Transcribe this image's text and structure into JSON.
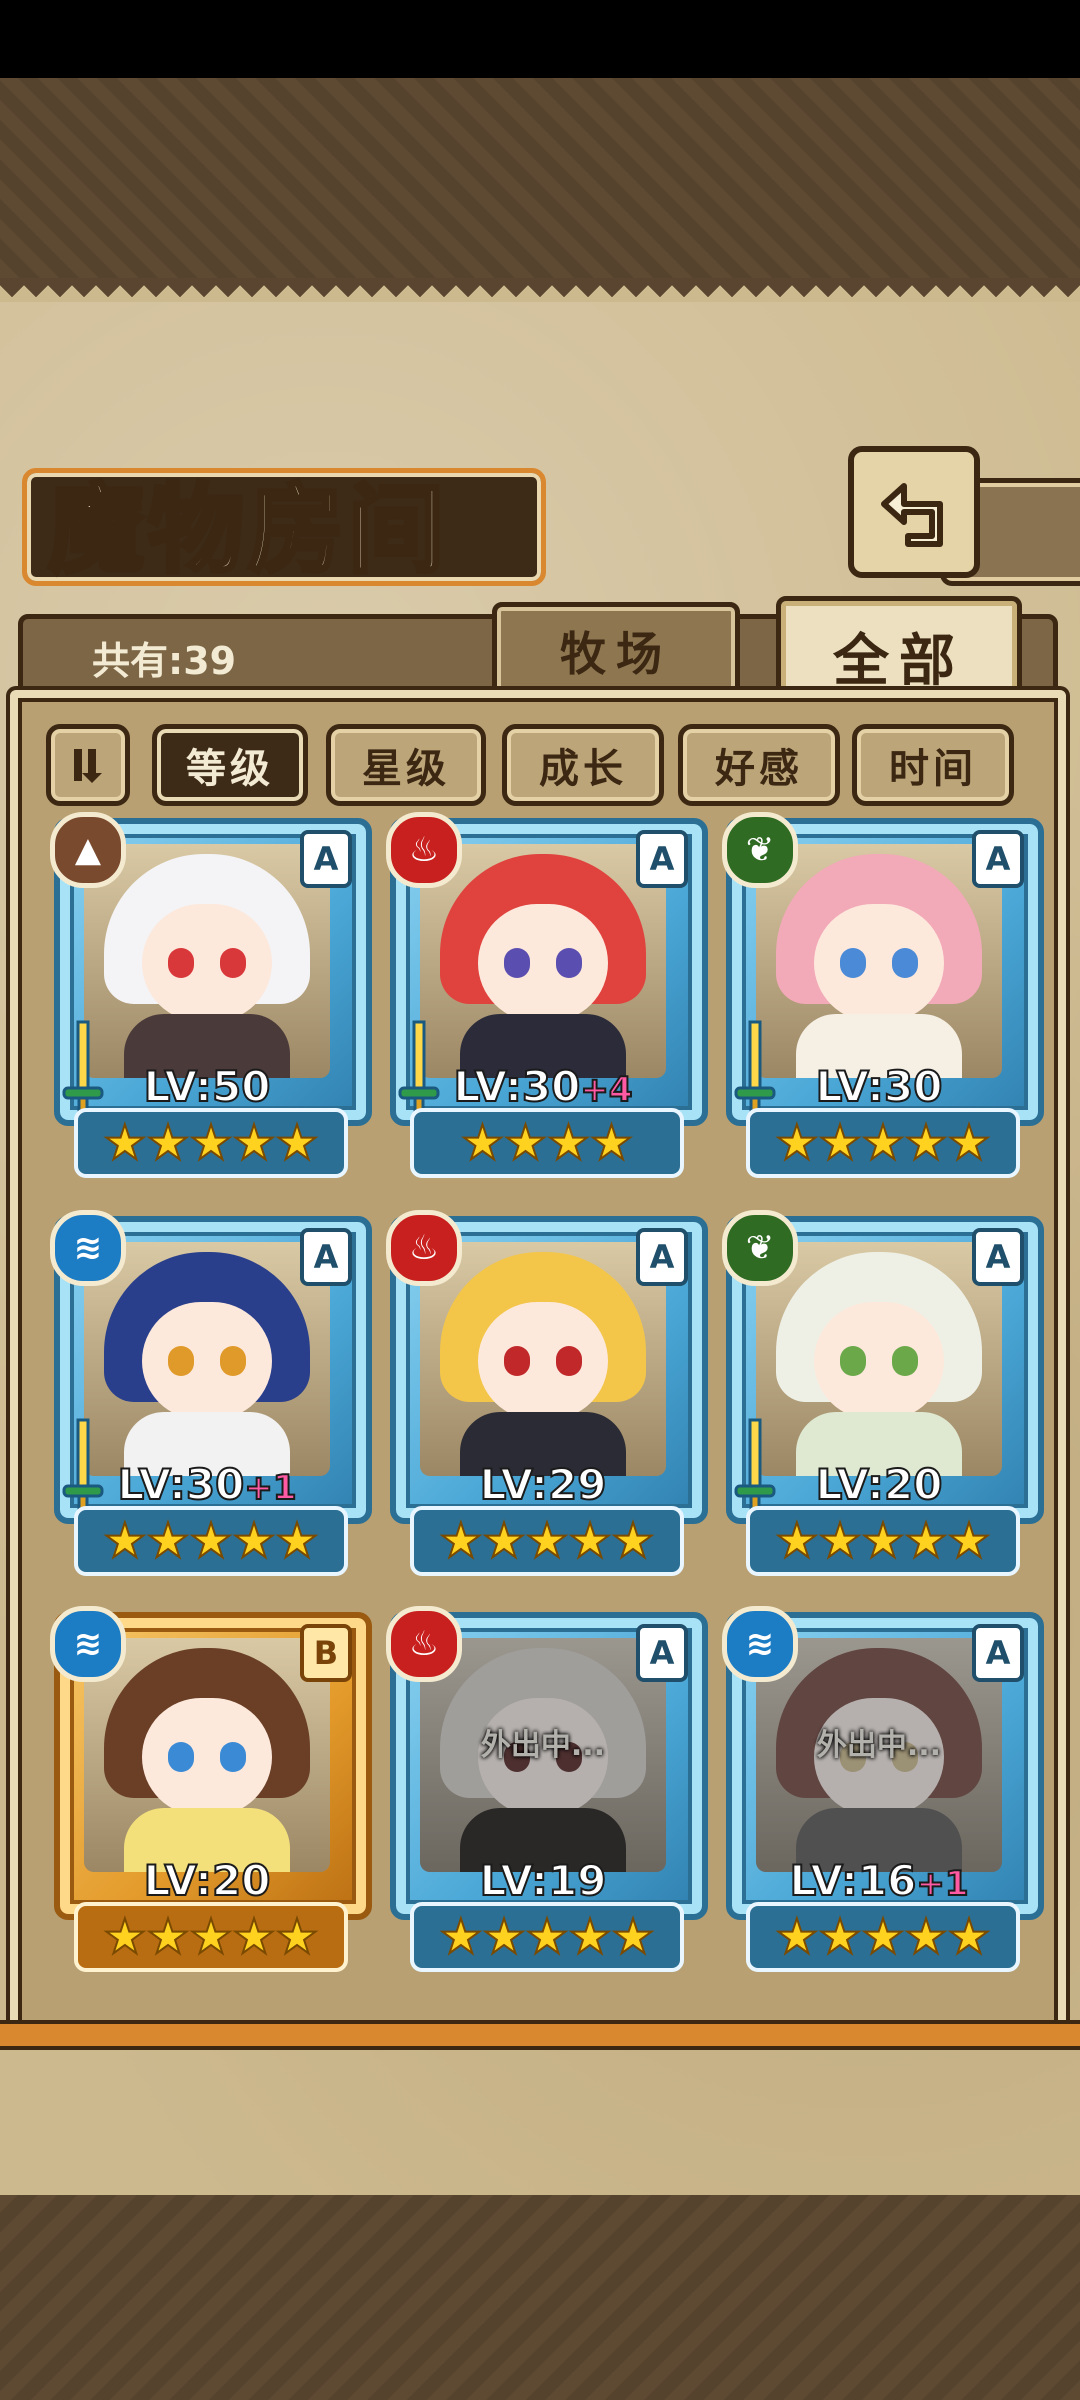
{
  "title": "魔物房间",
  "back_icon": "back-arrow-icon",
  "count_label": "共有:39",
  "tabs": {
    "farm": "牧场",
    "all": "全部"
  },
  "filters": [
    "等级",
    "星级",
    "成长",
    "好感",
    "时间"
  ],
  "sort_icon": "sort-toggle-icon",
  "colors": {
    "fire": "#c8201e",
    "water": "#1c7cc4",
    "leaf": "#2f6b22",
    "earth": "#7a4a2e",
    "frame_blue": "#4aa7d6",
    "frame_gold": "#e39a2a"
  },
  "monsters": [
    {
      "element": "earth",
      "element_icon": "earth-element-icon",
      "rank": "A",
      "level": "LV:50",
      "bonus": "",
      "stars": "★★★★★",
      "weapon": true,
      "frame": "blue",
      "status": "",
      "hair": "#f4f4f6",
      "eye": "#d9383a",
      "body": "#4a3a3a"
    },
    {
      "element": "fire",
      "element_icon": "fire-element-icon",
      "rank": "A",
      "level": "LV:30",
      "bonus": "+4",
      "stars": "★★★★",
      "weapon": true,
      "frame": "blue",
      "status": "",
      "hair": "#e0423e",
      "eye": "#5a4fb0",
      "body": "#2b2b3a"
    },
    {
      "element": "leaf",
      "element_icon": "leaf-element-icon",
      "rank": "A",
      "level": "LV:30",
      "bonus": "",
      "stars": "★★★★★",
      "weapon": true,
      "frame": "blue",
      "status": "",
      "hair": "#f2a9b8",
      "eye": "#4a8ad6",
      "body": "#f5efe4"
    },
    {
      "element": "water",
      "element_icon": "water-element-icon",
      "rank": "A",
      "level": "LV:30",
      "bonus": "+1",
      "stars": "★★★★★",
      "weapon": true,
      "frame": "blue",
      "status": "",
      "hair": "#2a3f8c",
      "eye": "#e09a2a",
      "body": "#f2f2f2"
    },
    {
      "element": "fire",
      "element_icon": "fire-element-icon",
      "rank": "A",
      "level": "LV:29",
      "bonus": "",
      "stars": "★★★★★",
      "weapon": false,
      "frame": "blue",
      "status": "",
      "hair": "#f3c64a",
      "eye": "#c0282a",
      "body": "#2b2b35"
    },
    {
      "element": "leaf",
      "element_icon": "leaf-element-icon",
      "rank": "A",
      "level": "LV:20",
      "bonus": "",
      "stars": "★★★★★",
      "weapon": true,
      "frame": "blue",
      "status": "",
      "hair": "#eef0e6",
      "eye": "#6aa84a",
      "body": "#dfe9d2"
    },
    {
      "element": "water",
      "element_icon": "water-element-icon",
      "rank": "B",
      "level": "LV:20",
      "bonus": "",
      "stars": "★★★★★",
      "weapon": false,
      "frame": "gold",
      "status": "",
      "hair": "#6a3f26",
      "eye": "#3a8ad6",
      "body": "#f3e07a"
    },
    {
      "element": "fire",
      "element_icon": "fire-element-icon",
      "rank": "A",
      "level": "LV:19",
      "bonus": "",
      "stars": "★★★★★",
      "weapon": false,
      "frame": "blue",
      "status": "外出中...",
      "hair": "#d8d2c4",
      "eye": "#b22a2a",
      "body": "#3a3530"
    },
    {
      "element": "water",
      "element_icon": "water-element-icon",
      "rank": "A",
      "level": "LV:16",
      "bonus": "+1",
      "stars": "★★★★★",
      "weapon": false,
      "frame": "blue",
      "status": "外出中...",
      "hair": "#c84a3a",
      "eye": "#f0c040",
      "body": "#6a6a6a"
    }
  ]
}
